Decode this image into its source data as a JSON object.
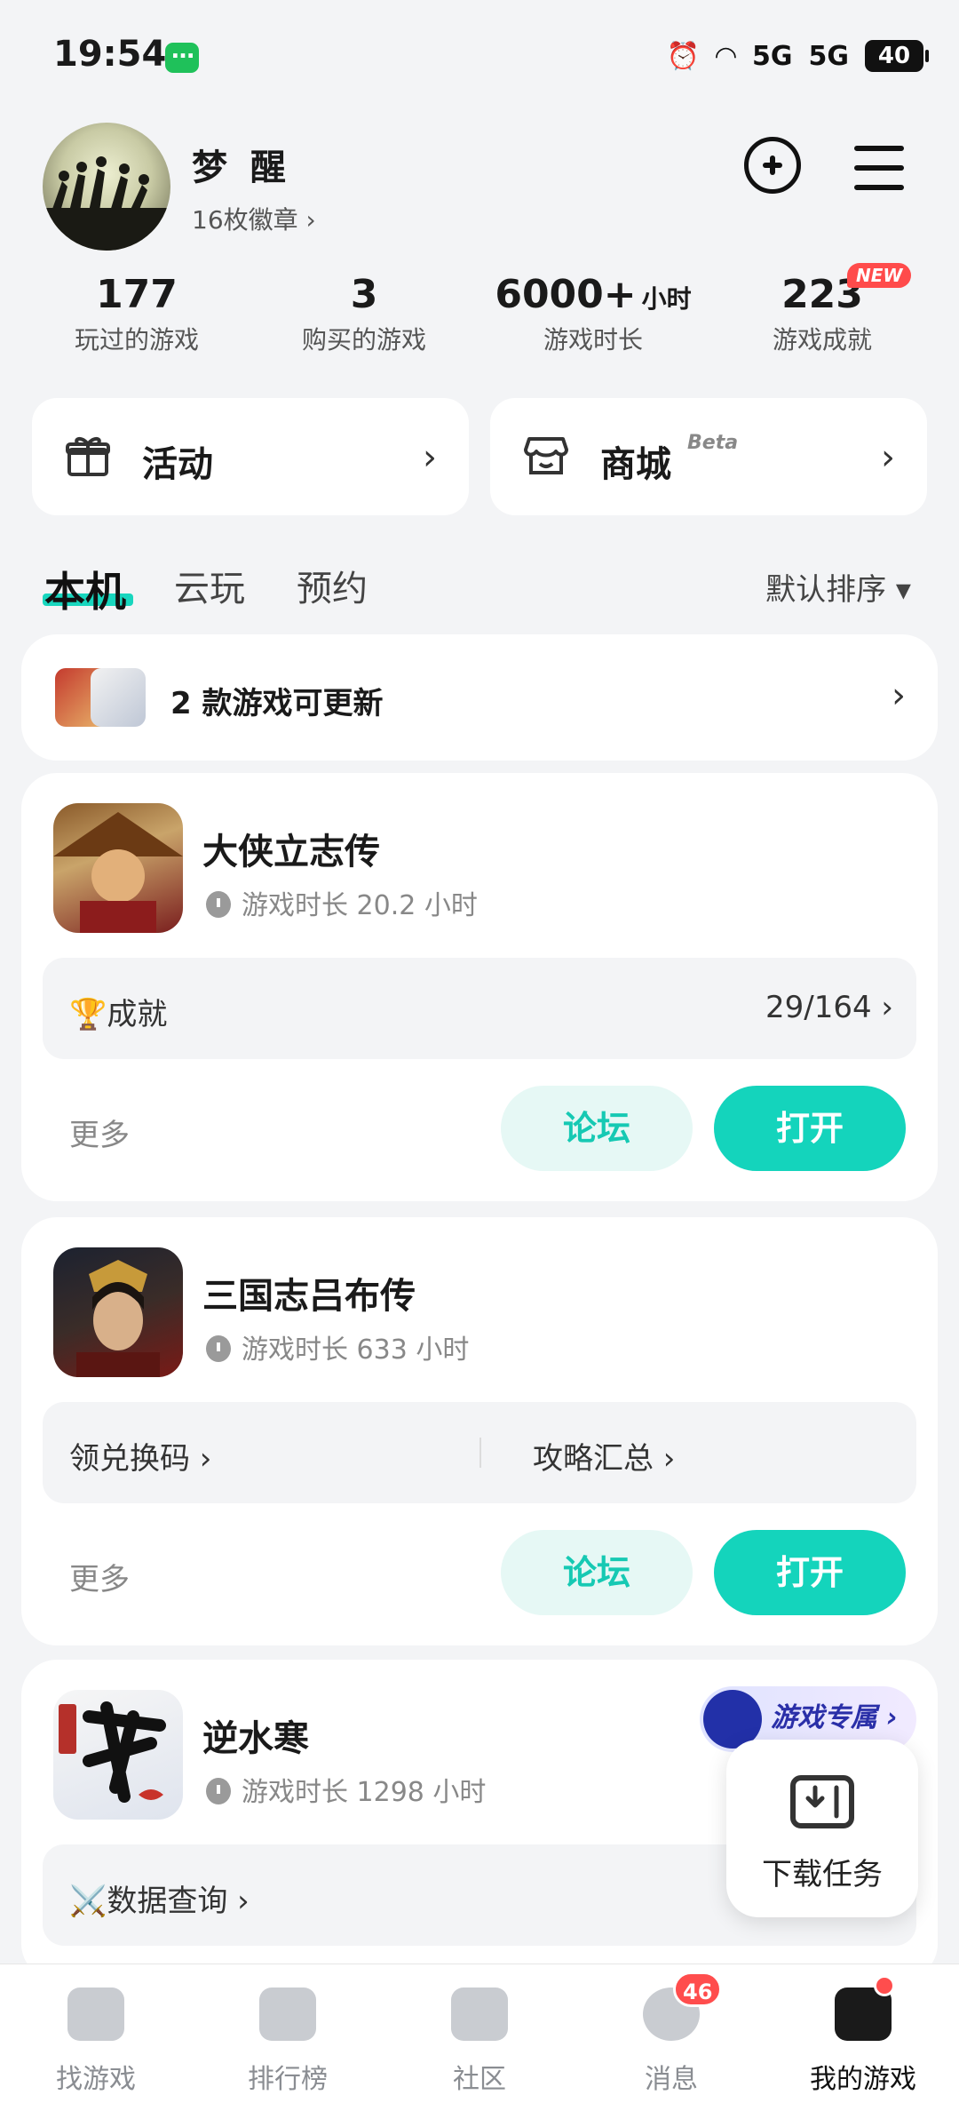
{
  "status_bar": {
    "time": "19:54",
    "battery": "40",
    "network_1": "5G",
    "network_2": "5G"
  },
  "profile": {
    "username": "梦 醒",
    "badges": "16枚徽章 ›"
  },
  "stats": [
    {
      "value": "177",
      "unit": "",
      "label": "玩过的游戏"
    },
    {
      "value": "3",
      "unit": "",
      "label": "购买的游戏"
    },
    {
      "value": "6000+",
      "unit": "小时",
      "label": "游戏时长"
    },
    {
      "value": "223",
      "unit": "",
      "label": "游戏成就"
    }
  ],
  "new_badge": "NEW",
  "quick_cards": {
    "activity": {
      "label": "活动",
      "chevron": "›"
    },
    "store": {
      "label": "商城",
      "tag": "Beta",
      "chevron": "›"
    }
  },
  "tabs": [
    {
      "label": "本机"
    },
    {
      "label": "云玩"
    },
    {
      "label": "预约"
    }
  ],
  "sort_label": "默认排序 ▾",
  "update_banner": {
    "text": "2 款游戏可更新",
    "chevron": "›"
  },
  "games": [
    {
      "title": "大侠立志传",
      "playtime": "游戏时长 20.2 小时",
      "achievement_label": "🏆成就",
      "achievement_value": "29/164 ›",
      "more": "更多",
      "forum": "论坛",
      "open": "打开"
    },
    {
      "title": "三国志吕布传",
      "playtime": "游戏时长 633 小时",
      "link_1": "领兑换码 ›",
      "link_2": "攻略汇总 ›",
      "more": "更多",
      "forum": "论坛",
      "open": "打开"
    },
    {
      "title": "逆水寒",
      "playtime": "游戏时长 1298 小时",
      "link_1": "⚔️数据查询 ›"
    }
  ],
  "promo": {
    "text": "游戏专属 ›"
  },
  "download_task": {
    "label": "下载任务"
  },
  "bottom_nav": [
    {
      "label": "找游戏"
    },
    {
      "label": "排行榜"
    },
    {
      "label": "社区"
    },
    {
      "label": "消息",
      "badge": "46"
    },
    {
      "label": "我的游戏"
    }
  ]
}
